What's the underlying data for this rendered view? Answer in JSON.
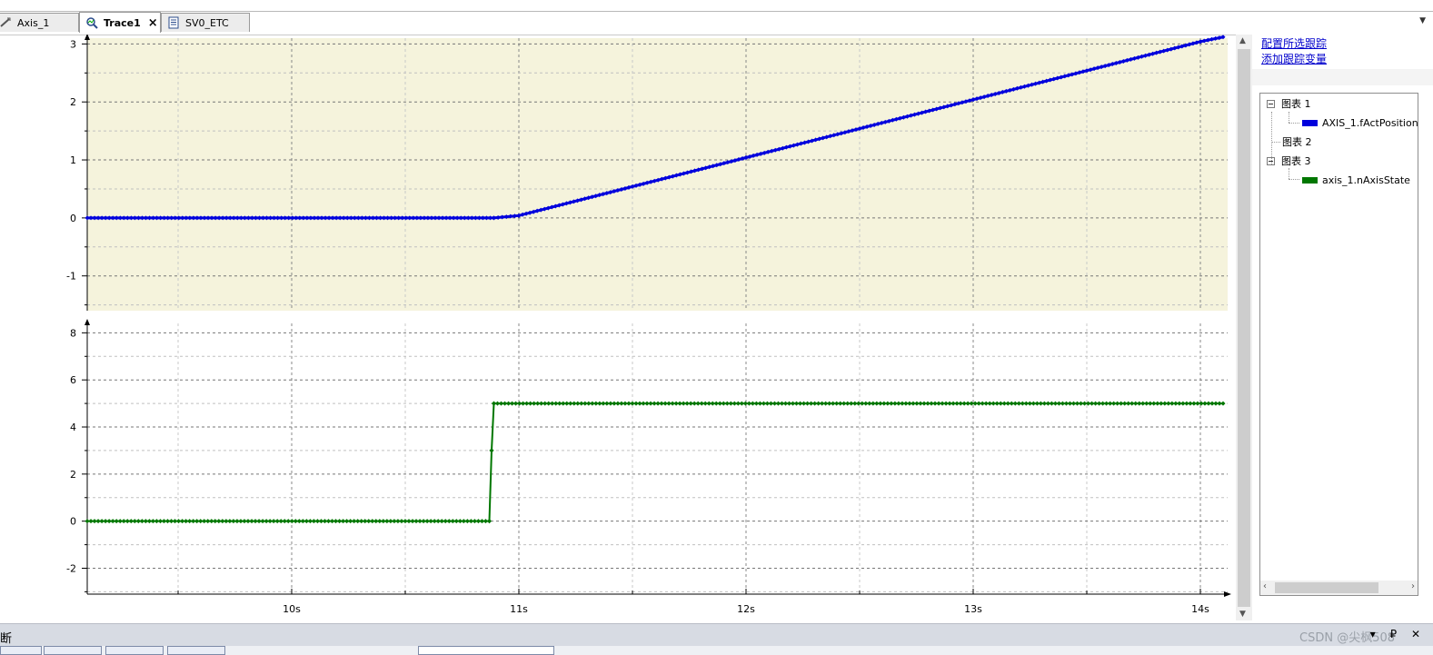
{
  "tabs": [
    {
      "label": "Axis_1",
      "icon": "axis-icon",
      "active": false
    },
    {
      "label": "Trace1",
      "icon": "trace-icon",
      "active": true,
      "closable": true
    },
    {
      "label": "SV0_ETC",
      "icon": "document-icon",
      "active": false
    }
  ],
  "tab_close_glyph": "×",
  "tab_menu_glyph": "▼",
  "links": {
    "configure": "配置所选跟踪",
    "add_variable": "添加跟踪变量"
  },
  "tree": [
    {
      "label": "图表 1",
      "expanded": true,
      "children": [
        {
          "label": "AXIS_1.fActPosition",
          "color": "#0000dd"
        }
      ]
    },
    {
      "label": "图表 2",
      "expanded": false,
      "children": []
    },
    {
      "label": "图表 3",
      "expanded": true,
      "children": [
        {
          "label": "axis_1.nAxisState",
          "color": "#007700"
        }
      ]
    }
  ],
  "bottom_panel": {
    "title": "断",
    "controls": "▾ ₽ ✕",
    "watermark": "CSDN @尖枫508"
  },
  "chart_data": [
    {
      "type": "line",
      "background": "#f5f3dc",
      "ylim": [
        -1.6,
        3.1
      ],
      "yticks": [
        -1,
        0,
        1,
        2,
        3
      ],
      "xlim": [
        9.1,
        14.12
      ],
      "xticks": [
        10,
        11,
        12,
        13,
        14
      ],
      "grid": true,
      "series": [
        {
          "name": "AXIS_1.fActPosition",
          "color": "#0000dd",
          "x": [
            9.1,
            10.89,
            11.0,
            12.0,
            13.0,
            14.0,
            14.1
          ],
          "y": [
            0,
            0,
            0.04,
            1.04,
            2.04,
            3.04,
            3.12
          ]
        }
      ]
    },
    {
      "type": "line",
      "background": "#ffffff",
      "ylim": [
        -3.1,
        8.4
      ],
      "yticks": [
        -2,
        0,
        2,
        4,
        6,
        8
      ],
      "xlim": [
        9.1,
        14.12
      ],
      "xticks": [
        10,
        11,
        12,
        13,
        14
      ],
      "xtick_labels": [
        "10s",
        "11s",
        "12s",
        "13s",
        "14s"
      ],
      "grid": true,
      "series": [
        {
          "name": "axis_1.nAxisState",
          "color": "#007700",
          "x": [
            9.1,
            10.87,
            10.88,
            10.89,
            14.1
          ],
          "y": [
            0,
            0,
            3,
            5,
            5
          ]
        }
      ]
    }
  ]
}
